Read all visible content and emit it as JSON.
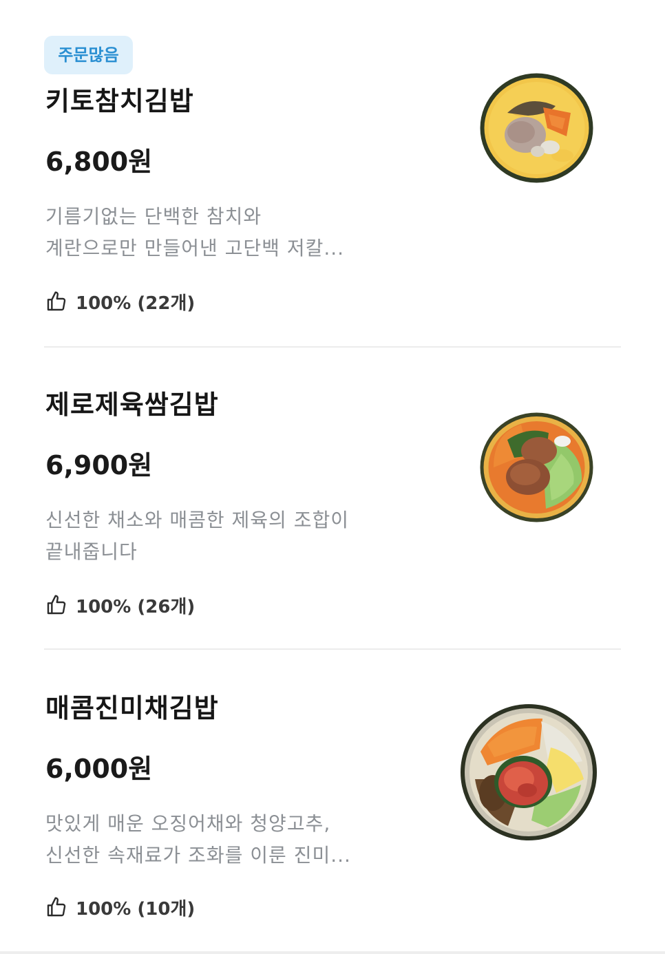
{
  "menu": {
    "items": [
      {
        "badge": "주문많음",
        "name": "키토참치김밥",
        "price": "6,800원",
        "desc_lines": [
          "기름기없는 단백한 참치와",
          "계란으로만 만들어낸 고단백 저칼..."
        ],
        "rating": "100% (22개)"
      },
      {
        "name": "제로제육쌈김밥",
        "price": "6,900원",
        "desc_lines": [
          "신선한 채소와 매콤한 제육의 조합이",
          "끝내줍니다"
        ],
        "rating": "100% (26개)"
      },
      {
        "name": "매콤진미채김밥",
        "price": "6,000원",
        "desc_lines": [
          "맛있게 매운 오징어채와 청양고추,",
          "신선한 속재료가 조화를 이룬 진미..."
        ],
        "rating": "100% (10개)"
      }
    ]
  },
  "icons": {
    "rating": "thumbs-up-icon"
  },
  "colors": {
    "badge_bg": "#dff0fb",
    "badge_text": "#2a8fd2",
    "desc_text": "#8b8f94"
  }
}
